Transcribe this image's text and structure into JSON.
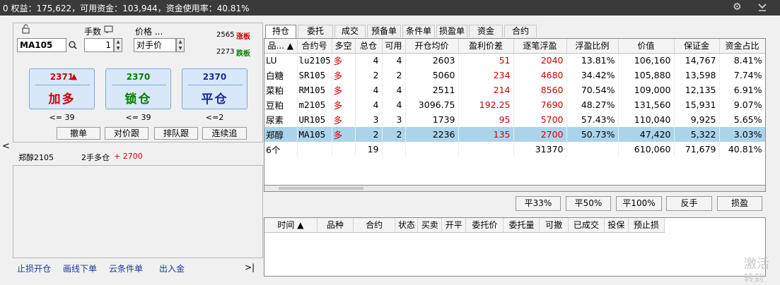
{
  "topbar": {
    "prefix": "0",
    "equity_label": "权益：",
    "equity": "175,622",
    "available_label": "，可用资金：",
    "available": "103,944",
    "usage_label": "，资金使用率：",
    "usage": "40.81%"
  },
  "order": {
    "symbol": "MA105",
    "qty_label": "手数",
    "qty": "1",
    "price_label": "价格 ...",
    "price_mode": "对手价",
    "limit_up_value": "2565",
    "limit_up_label": "涨板",
    "limit_down_value": "2273",
    "limit_down_label": "跌板",
    "buttons": [
      {
        "price": "2371",
        "arrow": "▲",
        "label": "加多",
        "note": "<= 39",
        "price_color": "#d00000",
        "label_color": "#d00000"
      },
      {
        "price": "2370",
        "arrow": "",
        "label": "锁仓",
        "note": "<= 39",
        "price_color": "#008000",
        "label_color": "#008000"
      },
      {
        "price": "2370",
        "arrow": "",
        "label": "平仓",
        "note": "<=2",
        "price_color": "#1a2a9a",
        "label_color": "#1a2a9a"
      }
    ],
    "small_buttons": [
      "撤单",
      "对价跟",
      "排队跟",
      "连续追"
    ],
    "collapse_arrow": "<"
  },
  "position_info": {
    "contract": "郑醇2105",
    "summary": "2手多仓",
    "pnl": "+ 2700"
  },
  "bottom_links": [
    "止损开仓",
    "画线下单",
    "云条件单",
    "出入金"
  ],
  "bottom_arrow": ">|",
  "tabs": [
    "持仓",
    "委托",
    "成交",
    "预备单",
    "条件单",
    "损盈单",
    "资金",
    "合约"
  ],
  "positions": {
    "headers": [
      "品... ▲",
      "合约号",
      "多空",
      "总仓",
      "可用",
      "开仓均价",
      "盈利价差",
      "逐笔浮盈",
      "浮盈比例",
      "价值",
      "保证金",
      "资金占比"
    ],
    "rows": [
      [
        "LU",
        "lu2105",
        "多",
        "4",
        "4",
        "2603",
        "51",
        "2040",
        "13.81%",
        "106,160",
        "14,767",
        "8.41%"
      ],
      [
        "白糖",
        "SR105",
        "多",
        "2",
        "2",
        "5060",
        "234",
        "4680",
        "34.42%",
        "105,880",
        "13,598",
        "7.74%"
      ],
      [
        "菜粕",
        "RM105",
        "多",
        "4",
        "4",
        "2511",
        "214",
        "8560",
        "70.54%",
        "109,000",
        "12,135",
        "6.91%"
      ],
      [
        "豆粕",
        "m2105",
        "多",
        "4",
        "4",
        "3096.75",
        "192.25",
        "7690",
        "48.27%",
        "131,560",
        "15,931",
        "9.07%"
      ],
      [
        "尿素",
        "UR105",
        "多",
        "3",
        "3",
        "1739",
        "95",
        "5700",
        "57.43%",
        "110,040",
        "9,925",
        "5.65%"
      ],
      [
        "郑醇",
        "MA105",
        "多",
        "2",
        "2",
        "2236",
        "135",
        "2700",
        "50.73%",
        "47,420",
        "5,322",
        "3.03%"
      ]
    ],
    "total": [
      "6个",
      "",
      "",
      "19",
      "",
      "",
      "",
      "31370",
      "",
      "610,060",
      "71,679",
      "40.81%"
    ]
  },
  "action_buttons": [
    "平33%",
    "平50%",
    "平100%",
    "反手",
    "损盈"
  ],
  "orders": {
    "headers": [
      "时间 ▲",
      "品种",
      "合约",
      "状态",
      "买卖",
      "开平",
      "委托价",
      "委托量",
      "可撤",
      "已成交",
      "投保",
      "预止损"
    ]
  },
  "watermark": [
    "激活",
    "转到"
  ],
  "colors": {
    "red": "#d00000",
    "green": "#008000",
    "blue": "#1a2a9a",
    "selected_row": "#a9d4ec"
  }
}
